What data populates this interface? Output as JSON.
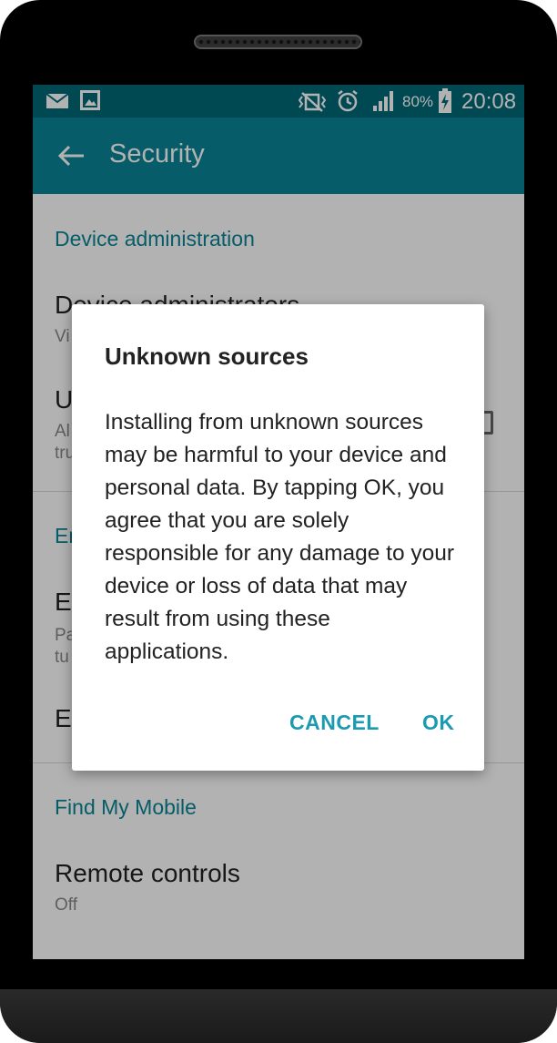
{
  "status_bar": {
    "battery": "80%",
    "time": "20:08",
    "icons": [
      "email-icon",
      "image-icon",
      "vibrate-icon",
      "alarm-icon",
      "signal-icon",
      "battery-charging-icon"
    ]
  },
  "app_bar": {
    "title": "Security",
    "back_icon": "arrow-back-icon"
  },
  "settings": {
    "device_admin_header": "Device administration",
    "device_admins_title": "Device administrators",
    "device_admins_sub": "Vi",
    "unknown_title": "U",
    "unknown_sub_1": "Al",
    "unknown_sub_2": "tru",
    "encryption_header": "En",
    "encrypt_title": "E",
    "encrypt_sub_1": "Pa",
    "encrypt_sub_2": "tu",
    "encrypt2_title": "E",
    "find_my_mobile_header": "Find My Mobile",
    "remote_controls_title": "Remote controls",
    "remote_controls_sub": "Off"
  },
  "dialog": {
    "title": "Unknown sources",
    "body": "Installing from unknown sources may be harmful to your device and personal data. By tapping OK, you agree that you are solely responsible for any damage to your device or loss of data that may result from using these applications.",
    "cancel_label": "CANCEL",
    "ok_label": "OK"
  },
  "colors": {
    "status_bar": "#006977",
    "app_bar": "#0a8596",
    "accent": "#1b9ab0"
  }
}
